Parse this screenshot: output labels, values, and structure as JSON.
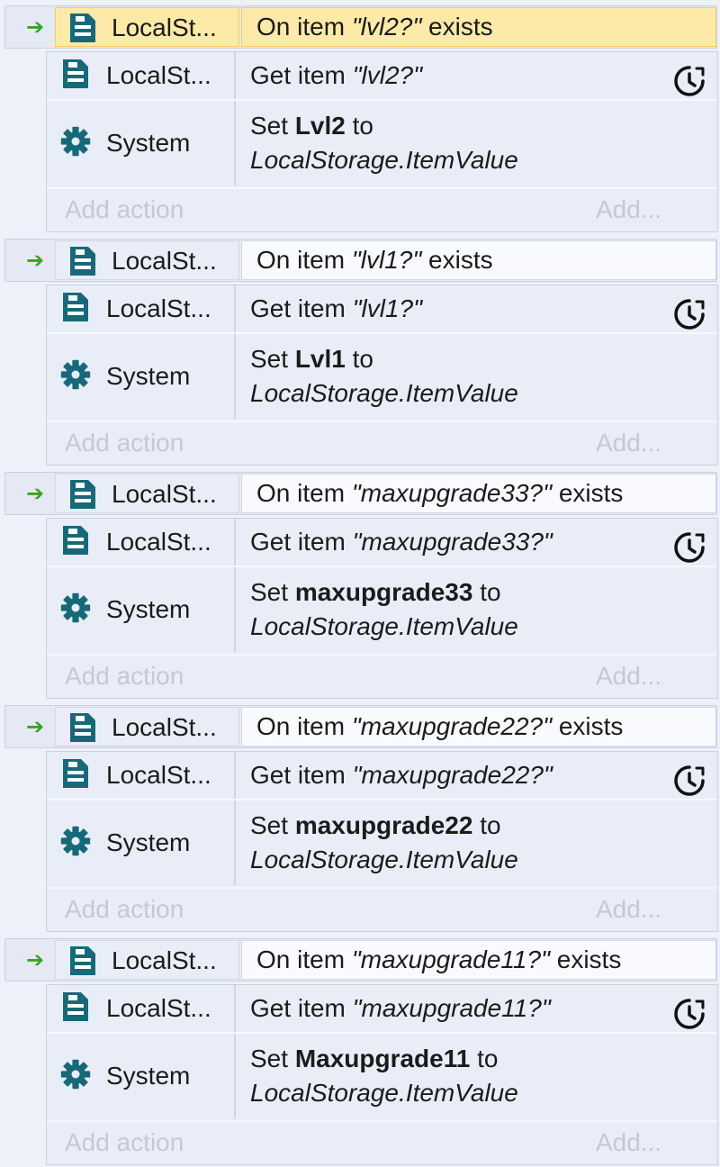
{
  "events": [
    {
      "selected": true,
      "condition": {
        "object": "LocalSt...",
        "prefix": "On item ",
        "key": "\"lvl2?\"",
        "suffix": " exists"
      },
      "actions": [
        {
          "object": "LocalSt...",
          "icon": "localstorage-icon",
          "prefix": "Get item ",
          "key": "\"lvl2?\"",
          "wait": true
        },
        {
          "object": "System",
          "icon": "gear-icon",
          "prefix": "Set ",
          "var": "Lvl2",
          "mid": " to ",
          "value": "LocalStorage.",
          "value2": "ItemValue"
        }
      ],
      "add_action": "Add action",
      "add_more": "Add..."
    },
    {
      "selected": false,
      "condition": {
        "object": "LocalSt...",
        "prefix": "On item ",
        "key": "\"lvl1?\"",
        "suffix": " exists"
      },
      "actions": [
        {
          "object": "LocalSt...",
          "icon": "localstorage-icon",
          "prefix": "Get item ",
          "key": "\"lvl1?\"",
          "wait": true
        },
        {
          "object": "System",
          "icon": "gear-icon",
          "prefix": "Set ",
          "var": "Lvl1",
          "mid": " to ",
          "value": "LocalStorage.",
          "value2": "ItemValue"
        }
      ],
      "add_action": "Add action",
      "add_more": "Add..."
    },
    {
      "selected": false,
      "condition": {
        "object": "LocalSt...",
        "prefix": "On item ",
        "key": "\"maxupgrade33?\"",
        "suffix": " exists"
      },
      "actions": [
        {
          "object": "LocalSt...",
          "icon": "localstorage-icon",
          "prefix": "Get item ",
          "key": "\"maxupgrade33?\"",
          "wait": true
        },
        {
          "object": "System",
          "icon": "gear-icon",
          "prefix": "Set ",
          "var": "maxupgrade33",
          "mid": " to",
          "value": "LocalStorage.ItemValue",
          "value2": ""
        }
      ],
      "add_action": "Add action",
      "add_more": "Add..."
    },
    {
      "selected": false,
      "condition": {
        "object": "LocalSt...",
        "prefix": "On item ",
        "key": "\"maxupgrade22?\"",
        "suffix": " exists"
      },
      "actions": [
        {
          "object": "LocalSt...",
          "icon": "localstorage-icon",
          "prefix": "Get item ",
          "key": "\"maxupgrade22?\"",
          "wait": true
        },
        {
          "object": "System",
          "icon": "gear-icon",
          "prefix": "Set ",
          "var": "maxupgrade22",
          "mid": " to",
          "value": "LocalStorage.ItemValue",
          "value2": ""
        }
      ],
      "add_action": "Add action",
      "add_more": "Add..."
    },
    {
      "selected": false,
      "condition": {
        "object": "LocalSt...",
        "prefix": "On item ",
        "key": "\"maxupgrade11?\"",
        "suffix": " exists"
      },
      "actions": [
        {
          "object": "LocalSt...",
          "icon": "localstorage-icon",
          "prefix": "Get item ",
          "key": "\"maxupgrade11?\"",
          "wait": true
        },
        {
          "object": "System",
          "icon": "gear-icon",
          "prefix": "Set ",
          "var": "Maxupgrade11",
          "mid": " to",
          "value": "LocalStorage.ItemValue",
          "value2": ""
        }
      ],
      "add_action": "Add action",
      "add_more": "Add..."
    }
  ],
  "colors": {
    "selected_fill": "#fdeaa8",
    "trigger_arrow": "#3fa122",
    "icon_teal": "#17697a",
    "placeholder_text": "#c3c9d6"
  }
}
